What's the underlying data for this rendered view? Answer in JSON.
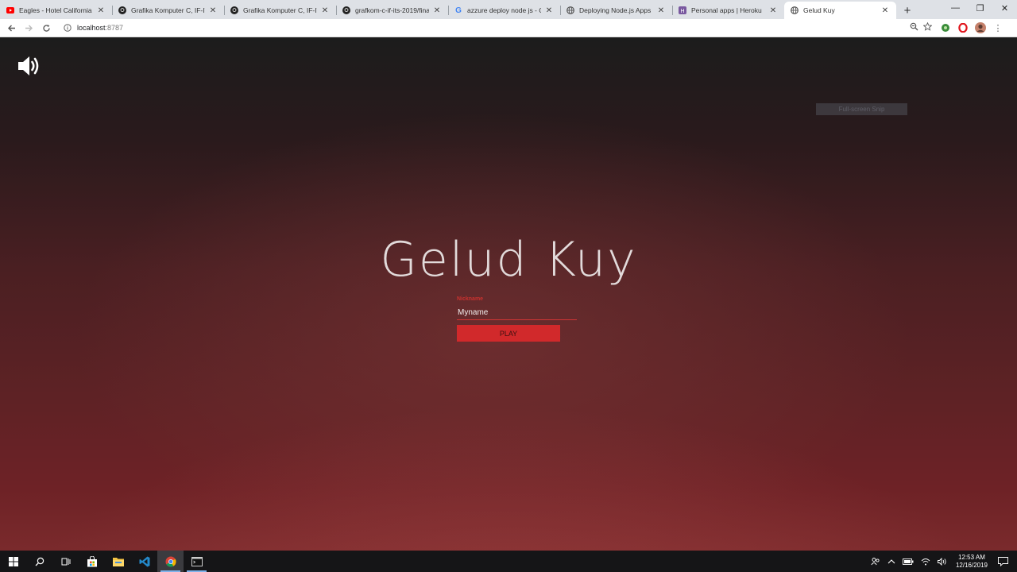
{
  "browser": {
    "tabs": [
      {
        "title": "Eagles - Hotel California (Li",
        "icon": "youtube-icon"
      },
      {
        "title": "Grafika Komputer C, IF-ITS",
        "icon": "github-icon"
      },
      {
        "title": "Grafika Komputer C, IF-ITS",
        "icon": "github-icon"
      },
      {
        "title": "grafkom-c-if-its-2019/final",
        "icon": "github-icon"
      },
      {
        "title": "azzure deploy node js - Goo",
        "icon": "google-icon"
      },
      {
        "title": "Deploying Node.js Apps on",
        "icon": "globe-icon"
      },
      {
        "title": "Personal apps | Heroku",
        "icon": "heroku-icon"
      },
      {
        "title": "Gelud Kuy",
        "icon": "globe-icon",
        "active": true
      }
    ],
    "url_host": "localhost",
    "url_port": ":8787"
  },
  "game": {
    "title": "Gelud Kuy",
    "fullscreen_hint": "Full-screen Snip",
    "nickname_label": "Nickname",
    "nickname_value": "Myname",
    "play_label": "PLAY"
  },
  "taskbar": {
    "time": "12:53 AM",
    "date": "12/16/2019"
  },
  "colors": {
    "accent": "#d1292b",
    "label": "#c8322f"
  }
}
